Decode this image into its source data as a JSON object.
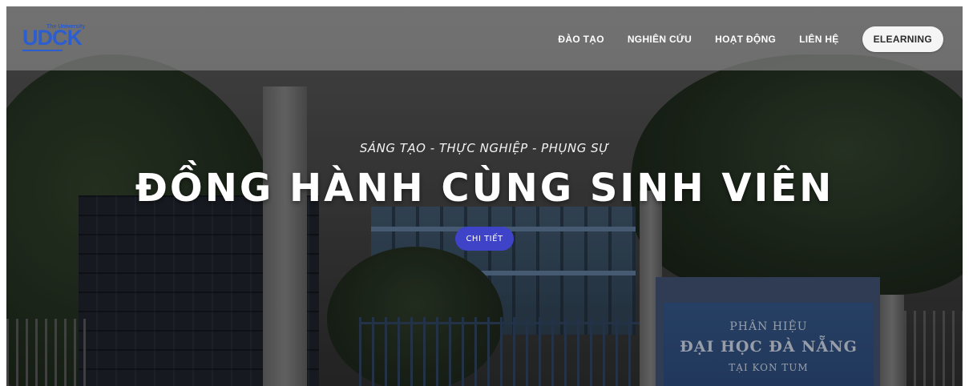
{
  "header": {
    "logo": {
      "small_text": "The University",
      "main_text": "UDCK"
    },
    "nav": [
      {
        "label": "ĐÀO TẠO"
      },
      {
        "label": "NGHIÊN CỨU"
      },
      {
        "label": "HOẠT ĐỘNG"
      },
      {
        "label": "LIÊN HỆ"
      }
    ],
    "elearning_button": "ELEARNING"
  },
  "hero": {
    "tagline": "SÁNG TẠO - THỰC NGHIỆP - PHỤNG SỰ",
    "headline": "ĐỒNG HÀNH CÙNG SINH VIÊN",
    "cta_label": "CHI TIẾT",
    "signboard": {
      "line1": "PHÂN HIỆU",
      "line2": "ĐẠI HỌC ĐÀ NẴNG",
      "line3": "TẠI KON TUM"
    }
  },
  "colors": {
    "brand_blue": "#2c5ed0",
    "cta_blue": "#3f43c7",
    "navbar_bg": "rgba(120,120,120,0.78)",
    "nav_text": "#ffffff"
  },
  "icons": []
}
